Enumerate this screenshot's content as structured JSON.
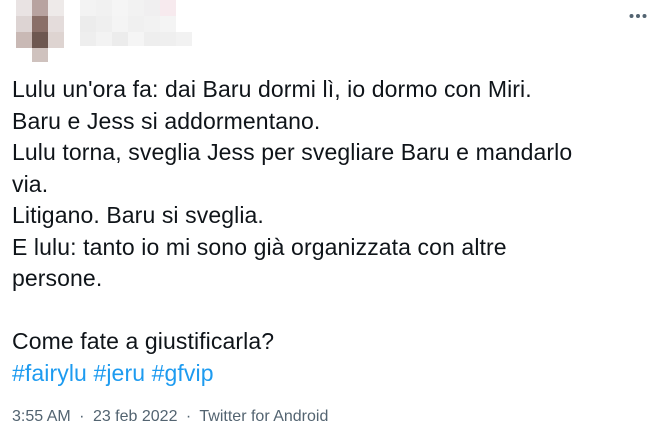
{
  "tweet": {
    "lines": [
      "Lulu un'ora fa: dai Baru dormi lì, io dormo con Miri.",
      "Baru e Jess si addormentano.",
      "Lulu torna, sveglia Jess per svegliare Baru e mandarlo",
      "via.",
      "Litigano. Baru si sveglia.",
      "E lulu: tanto io mi sono già organizzata con altre",
      "persone.",
      "",
      "Come fate a giustificarla?"
    ],
    "hashtags": [
      "#fairylu",
      "#jeru",
      "#gfvip"
    ]
  },
  "meta": {
    "time": "3:55 AM",
    "separator": "·",
    "date": "23 feb 2022",
    "source": "Twitter for Android"
  },
  "colors": {
    "text": "#0f1419",
    "link": "#1d9bf0",
    "secondary": "#536471"
  },
  "icons": {
    "more": "more-dots-icon"
  }
}
